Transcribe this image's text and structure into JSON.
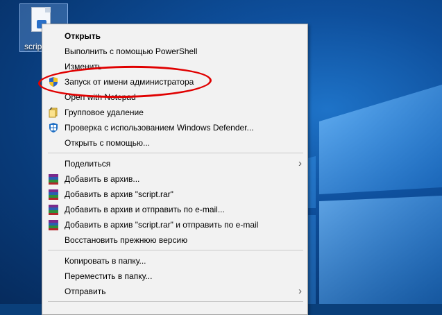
{
  "desktop": {
    "icon_caption": "scrip"
  },
  "context_menu": {
    "items": [
      {
        "label": "Открыть",
        "icon": "none"
      },
      {
        "label": "Выполнить с помощью PowerShell",
        "icon": "none"
      },
      {
        "label": "Изменить",
        "icon": "none"
      },
      {
        "label": "Запуск от имени администратора",
        "icon": "uac-shield-icon"
      },
      {
        "label": "Open with Notepad",
        "icon": "none"
      },
      {
        "label": "Групповое удаление",
        "icon": "group-delete-icon"
      },
      {
        "label": "Проверка с использованием Windows Defender...",
        "icon": "windows-defender-icon"
      },
      {
        "label": "Открыть с помощью...",
        "icon": "none"
      },
      {
        "label": "Поделиться",
        "icon": "none",
        "submenu": true
      },
      {
        "label": "Добавить в архив...",
        "icon": "winrar-icon"
      },
      {
        "label": "Добавить в архив \"script.rar\"",
        "icon": "winrar-icon"
      },
      {
        "label": "Добавить в архив и отправить по e-mail...",
        "icon": "winrar-icon"
      },
      {
        "label": "Добавить в архив \"script.rar\" и отправить по e-mail",
        "icon": "winrar-icon"
      },
      {
        "label": "Восстановить прежнюю версию",
        "icon": "none"
      },
      {
        "label": "Копировать в папку...",
        "icon": "none"
      },
      {
        "label": "Переместить в папку...",
        "icon": "none"
      },
      {
        "label": "Отправить",
        "icon": "none",
        "submenu": true
      }
    ],
    "submenu_arrow": "›"
  },
  "colors": {
    "highlight_ellipse": "#e00000",
    "menu_background": "#f2f2f2"
  }
}
